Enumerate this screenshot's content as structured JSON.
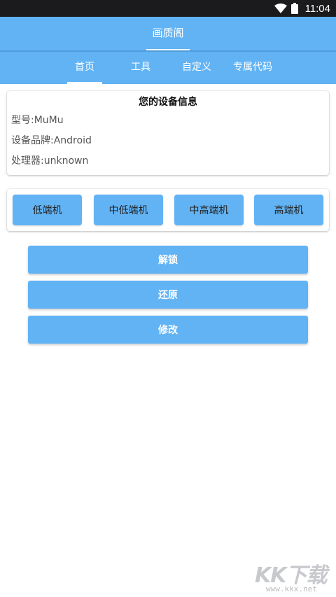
{
  "status_bar": {
    "time": "11:04",
    "icons": [
      "wifi-icon",
      "battery-icon"
    ],
    "background": "#1b1b1d"
  },
  "app_bar": {
    "title": "画质阁",
    "color": "#62b3f4"
  },
  "tabs": [
    {
      "label": "首页",
      "selected": true
    },
    {
      "label": "工具",
      "selected": false
    },
    {
      "label": "自定义",
      "selected": false
    },
    {
      "label": "专属代码",
      "selected": false
    }
  ],
  "device_info": {
    "title": "您的设备信息",
    "model": "型号:MuMu",
    "brand": "设备品牌:Android",
    "processor": "处理器:unknown"
  },
  "tiers": {
    "low": "低端机",
    "mid_low": "中低端机",
    "mid_high": "中高端机",
    "high": "高端机"
  },
  "actions": {
    "unlock": "解锁",
    "restore": "还原",
    "modify": "修改"
  },
  "watermark": {
    "logo": "KK下载",
    "url": "www.kkx.net"
  }
}
